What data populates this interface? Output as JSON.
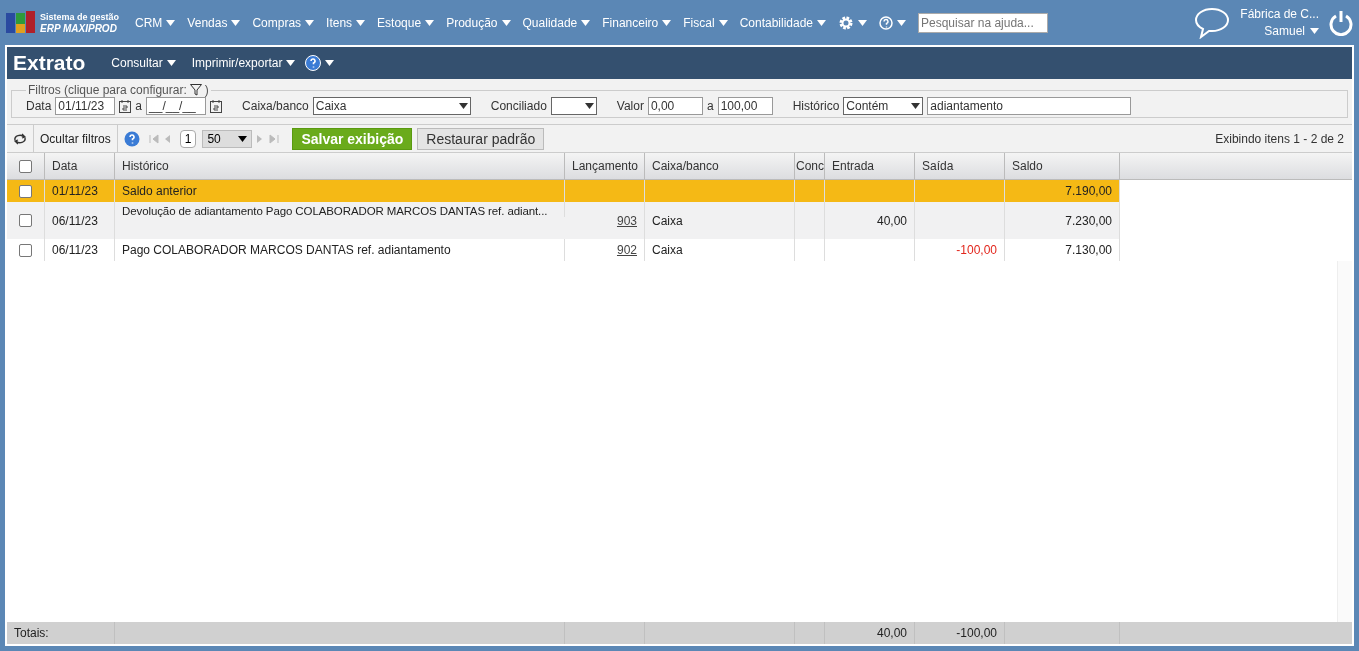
{
  "app": {
    "logo_line1": "Sistema de gestão",
    "logo_line2": "ERP MAXIPROD"
  },
  "menu": [
    {
      "label": "CRM"
    },
    {
      "label": "Vendas"
    },
    {
      "label": "Compras"
    },
    {
      "label": "Itens"
    },
    {
      "label": "Estoque"
    },
    {
      "label": "Produção"
    },
    {
      "label": "Qualidade"
    },
    {
      "label": "Financeiro"
    },
    {
      "label": "Fiscal"
    },
    {
      "label": "Contabilidade"
    }
  ],
  "help_search": {
    "placeholder": "Pesquisar na ajuda..."
  },
  "user": {
    "company": "Fábrica de C...",
    "name": "Samuel"
  },
  "page": {
    "title": "Extrato",
    "actions": [
      {
        "label": "Consultar"
      },
      {
        "label": "Imprimir/exportar"
      }
    ]
  },
  "filters": {
    "legend": "Filtros (clique para configurar:",
    "legend_end": ")",
    "date_label": "Data",
    "date_from": "01/11/23",
    "date_sep": "a",
    "date_to": "__/__/__",
    "bank_label": "Caixa/banco",
    "bank": "Caixa",
    "reconciled_label": "Conciliado",
    "value_label": "Valor",
    "value_from": "0,00",
    "value_sep": "a",
    "value_to": "100,00",
    "history_label": "Histórico",
    "history_mode": "Contém",
    "history_text": "adiantamento"
  },
  "toolbar": {
    "hide_filters": "Ocultar filtros",
    "page": "1",
    "page_size": "50",
    "save": "Salvar exibição",
    "restore": "Restaurar padrão",
    "summary": "Exibindo itens 1 - 2 de 2"
  },
  "table": {
    "select_all_checked": false,
    "columns": [
      "Data",
      "Histórico",
      "Lançamento",
      "Caixa/banco",
      "Conc",
      "Entrada",
      "Saída",
      "Saldo"
    ],
    "rows": [
      {
        "kind": "balance",
        "checked": false,
        "date": "01/11/23",
        "history": "Saldo anterior",
        "entry_no": "",
        "bank": "",
        "in": "",
        "out": "",
        "balance": "7.190,00"
      },
      {
        "kind": "entry",
        "checked": false,
        "date": "06/11/23",
        "history": "Devolução de adiantamento Pago COLABORADOR MARCOS DANTAS ref. adiant...",
        "entry_no": "903",
        "bank": "Caixa",
        "in": "40,00",
        "out": "",
        "balance": "7.230,00"
      },
      {
        "kind": "entry",
        "checked": false,
        "date": "06/11/23",
        "history": "Pago COLABORADOR MARCOS DANTAS ref. adiantamento",
        "entry_no": "902",
        "bank": "Caixa",
        "in": "",
        "out": "-100,00",
        "balance": "7.130,00"
      }
    ],
    "totals": {
      "label": "Totais:",
      "in": "40,00",
      "out": "-100,00"
    }
  }
}
